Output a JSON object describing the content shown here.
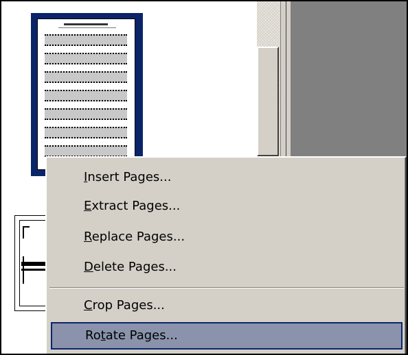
{
  "menu": {
    "items": [
      {
        "pre": "",
        "acc": "I",
        "post": "nsert Pages..."
      },
      {
        "pre": "",
        "acc": "E",
        "post": "xtract Pages..."
      },
      {
        "pre": "",
        "acc": "R",
        "post": "eplace Pages..."
      },
      {
        "pre": "",
        "acc": "D",
        "post": "elete Pages..."
      },
      {
        "pre": "",
        "acc": "C",
        "post": "rop Pages..."
      },
      {
        "pre": "Ro",
        "acc": "t",
        "post": "ate Pages..."
      }
    ],
    "highlighted_index": 5
  },
  "colors": {
    "menu_bg": "#d4d0c8",
    "highlight": "#8a93ab",
    "selection_border": "#0a246a",
    "doc_area": "#808080"
  }
}
